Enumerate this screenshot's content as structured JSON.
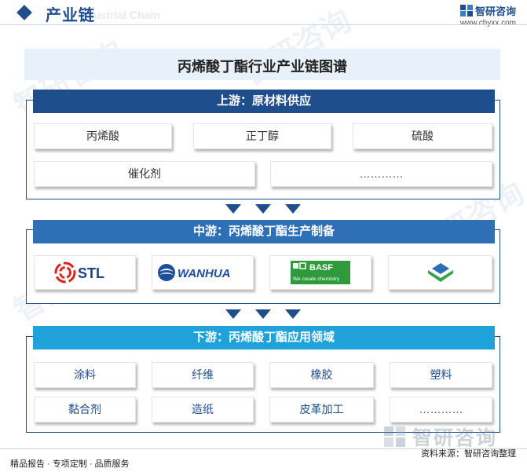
{
  "header": {
    "title": "产业链",
    "subtitle_ghost": "Industrial Chain",
    "brand_name": "智研咨询",
    "brand_url": "www.chyxx.com",
    "brand_color": "#1f4e8c"
  },
  "diagram": {
    "title": "丙烯酸丁酯行业产业链图谱",
    "upstream": {
      "title": "上游：原材料供应",
      "row1": [
        "丙烯酸",
        "正丁醇",
        "硫酸"
      ],
      "row2": [
        "催化剂",
        "…………"
      ]
    },
    "midstream": {
      "title": "中游：丙烯酸丁酯生产制备",
      "logos": [
        {
          "icon": "stl-logo",
          "text": "STL"
        },
        {
          "icon": "wanhua-logo",
          "text": "WANHUA"
        },
        {
          "icon": "basf-logo",
          "text": "BASF",
          "tagline": "We create chemistry"
        },
        {
          "icon": "company-logo",
          "text": ""
        }
      ]
    },
    "downstream": {
      "title": "下游：丙烯酸丁酯应用领域",
      "row1": [
        "涂料",
        "纤维",
        "橡胶",
        "塑料"
      ],
      "row2": [
        "黏合剂",
        "造纸",
        "皮革加工",
        "…………"
      ]
    },
    "colors": {
      "upstream": "#1f4e8c",
      "midstream": "#2f6fb6",
      "downstream": "#1ea2d9"
    }
  },
  "footer": {
    "left": "精品报告 · 专项定制 · 品质服务",
    "source": "资料来源：智研咨询整理",
    "brand_name": "智研咨询"
  }
}
